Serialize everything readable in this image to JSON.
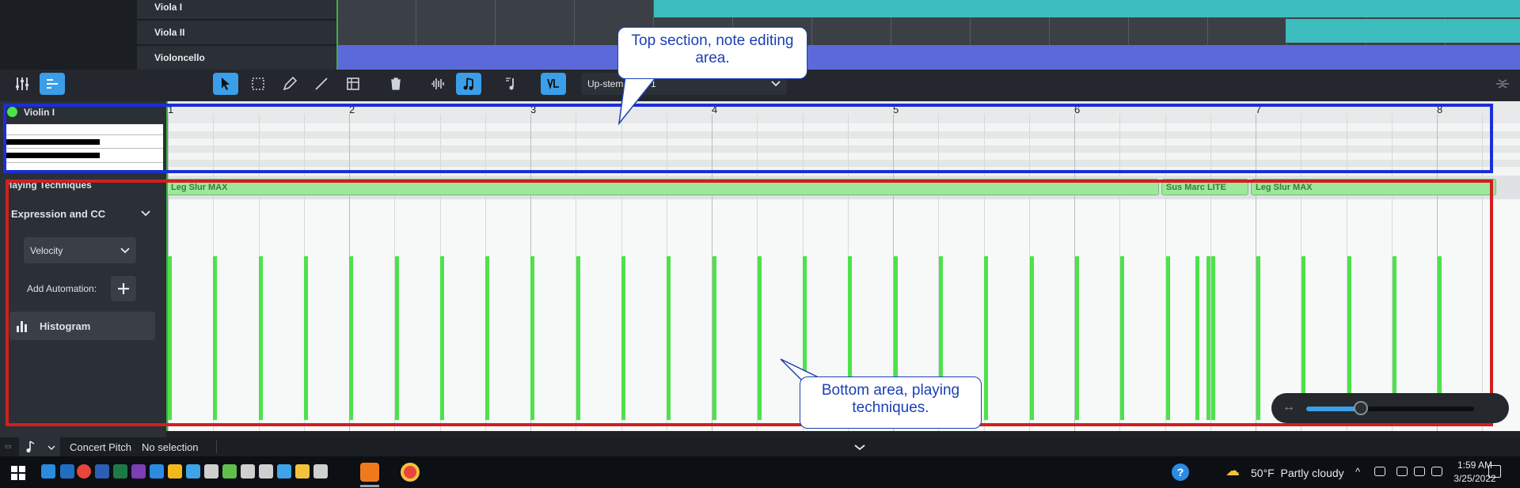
{
  "tracks": [
    {
      "name": "Viola I",
      "color": "#3ec4d6"
    },
    {
      "name": "Viola II",
      "color": "#3ec4d6"
    },
    {
      "name": "Violoncello",
      "color": "#5a6fe0"
    }
  ],
  "toolbar": {
    "voice_label": "Up-stem voice 1"
  },
  "editor": {
    "track_label": "Violin I",
    "bar_numbers": [
      "1",
      "2",
      "3",
      "4",
      "5",
      "6",
      "7",
      "8"
    ],
    "playing_techniques_label": "Playing Techniques",
    "expression_label": "Expression and CC",
    "velocity_label": "Velocity",
    "add_automation_label": "Add Automation:",
    "histogram_label": "Histogram",
    "techniques": [
      {
        "label": "Leg Slur MAX"
      },
      {
        "label": "Sus Marc LITE"
      },
      {
        "label": "Leg Slur MAX"
      }
    ]
  },
  "annotations": {
    "top_callout": "Top section, note editing area.",
    "bottom_callout": "Bottom area, playing techniques."
  },
  "status": {
    "concert_pitch": "Concert Pitch",
    "selection": "No selection"
  },
  "taskbar": {
    "weather": "50°F  Partly cloudy",
    "time": "1:59 AM",
    "date": "3/25/2022"
  },
  "colors": {
    "accent": "#3b9ee8",
    "note_area_outline": "#1a2fd6",
    "technique_area_outline": "#d11f1f",
    "velocity_bar": "#4de14a"
  },
  "icons": [
    "mixer-icon",
    "editor-icon",
    "select-arrow-icon",
    "marquee-icon",
    "pencil-icon",
    "line-icon",
    "range-icon",
    "trash-icon",
    "waveform-icon",
    "note-icon",
    "note-input-icon",
    "violin-technique-icon",
    "chevron-down-icon",
    "plus-icon",
    "histogram-icon",
    "windows-start-icon",
    "help-icon",
    "weather-icon",
    "notification-icon"
  ]
}
